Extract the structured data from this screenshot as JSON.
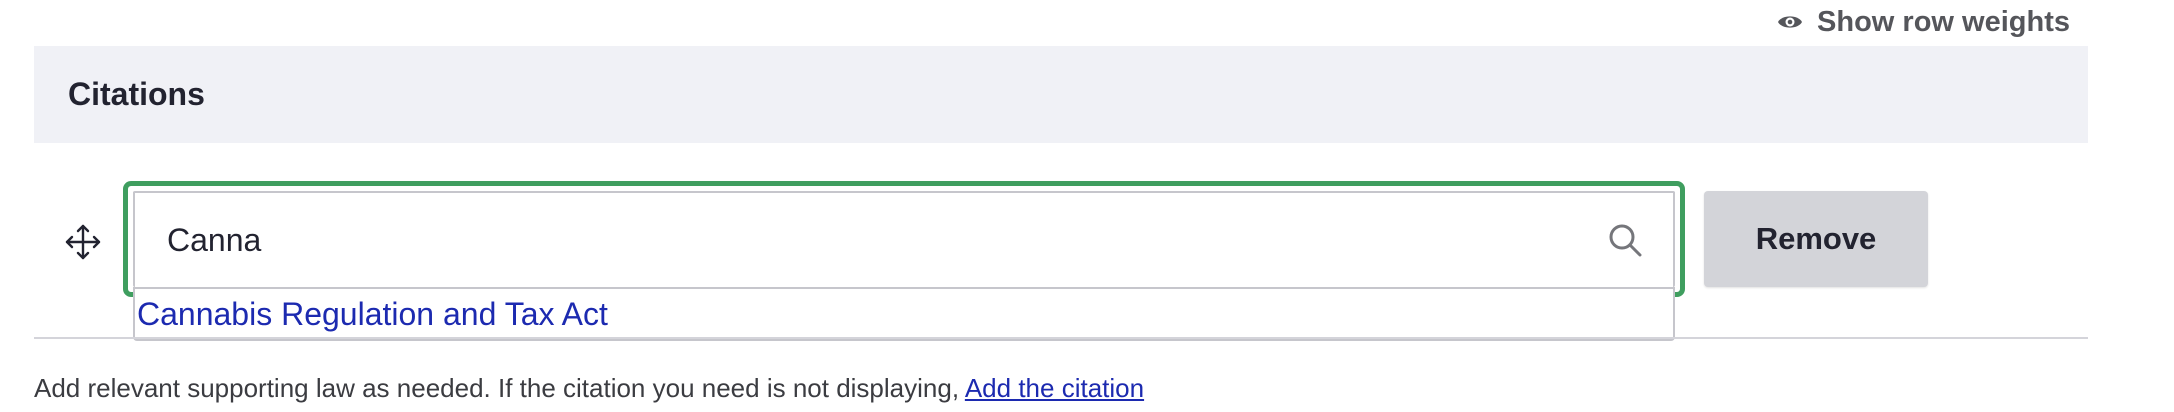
{
  "tabledrag": {
    "show_weights_label": "Show row weights",
    "icon": "eye-icon"
  },
  "section": {
    "title": "Citations"
  },
  "row": {
    "drag_icon": "move-arrows-icon",
    "input_value": "Canna",
    "search_icon": "search-icon",
    "remove_label": "Remove",
    "focus_color": "#3f9e5f"
  },
  "autocomplete": {
    "items": [
      {
        "label": "Cannabis Regulation and Tax Act"
      }
    ]
  },
  "help": {
    "text": "Add relevant supporting law as needed. If the citation you need is not displaying, ",
    "link_label": "Add the citation"
  },
  "colors": {
    "header_background": "#f0f1f6",
    "link": "#1c2ab0",
    "button_background": "#d3d4d9"
  }
}
